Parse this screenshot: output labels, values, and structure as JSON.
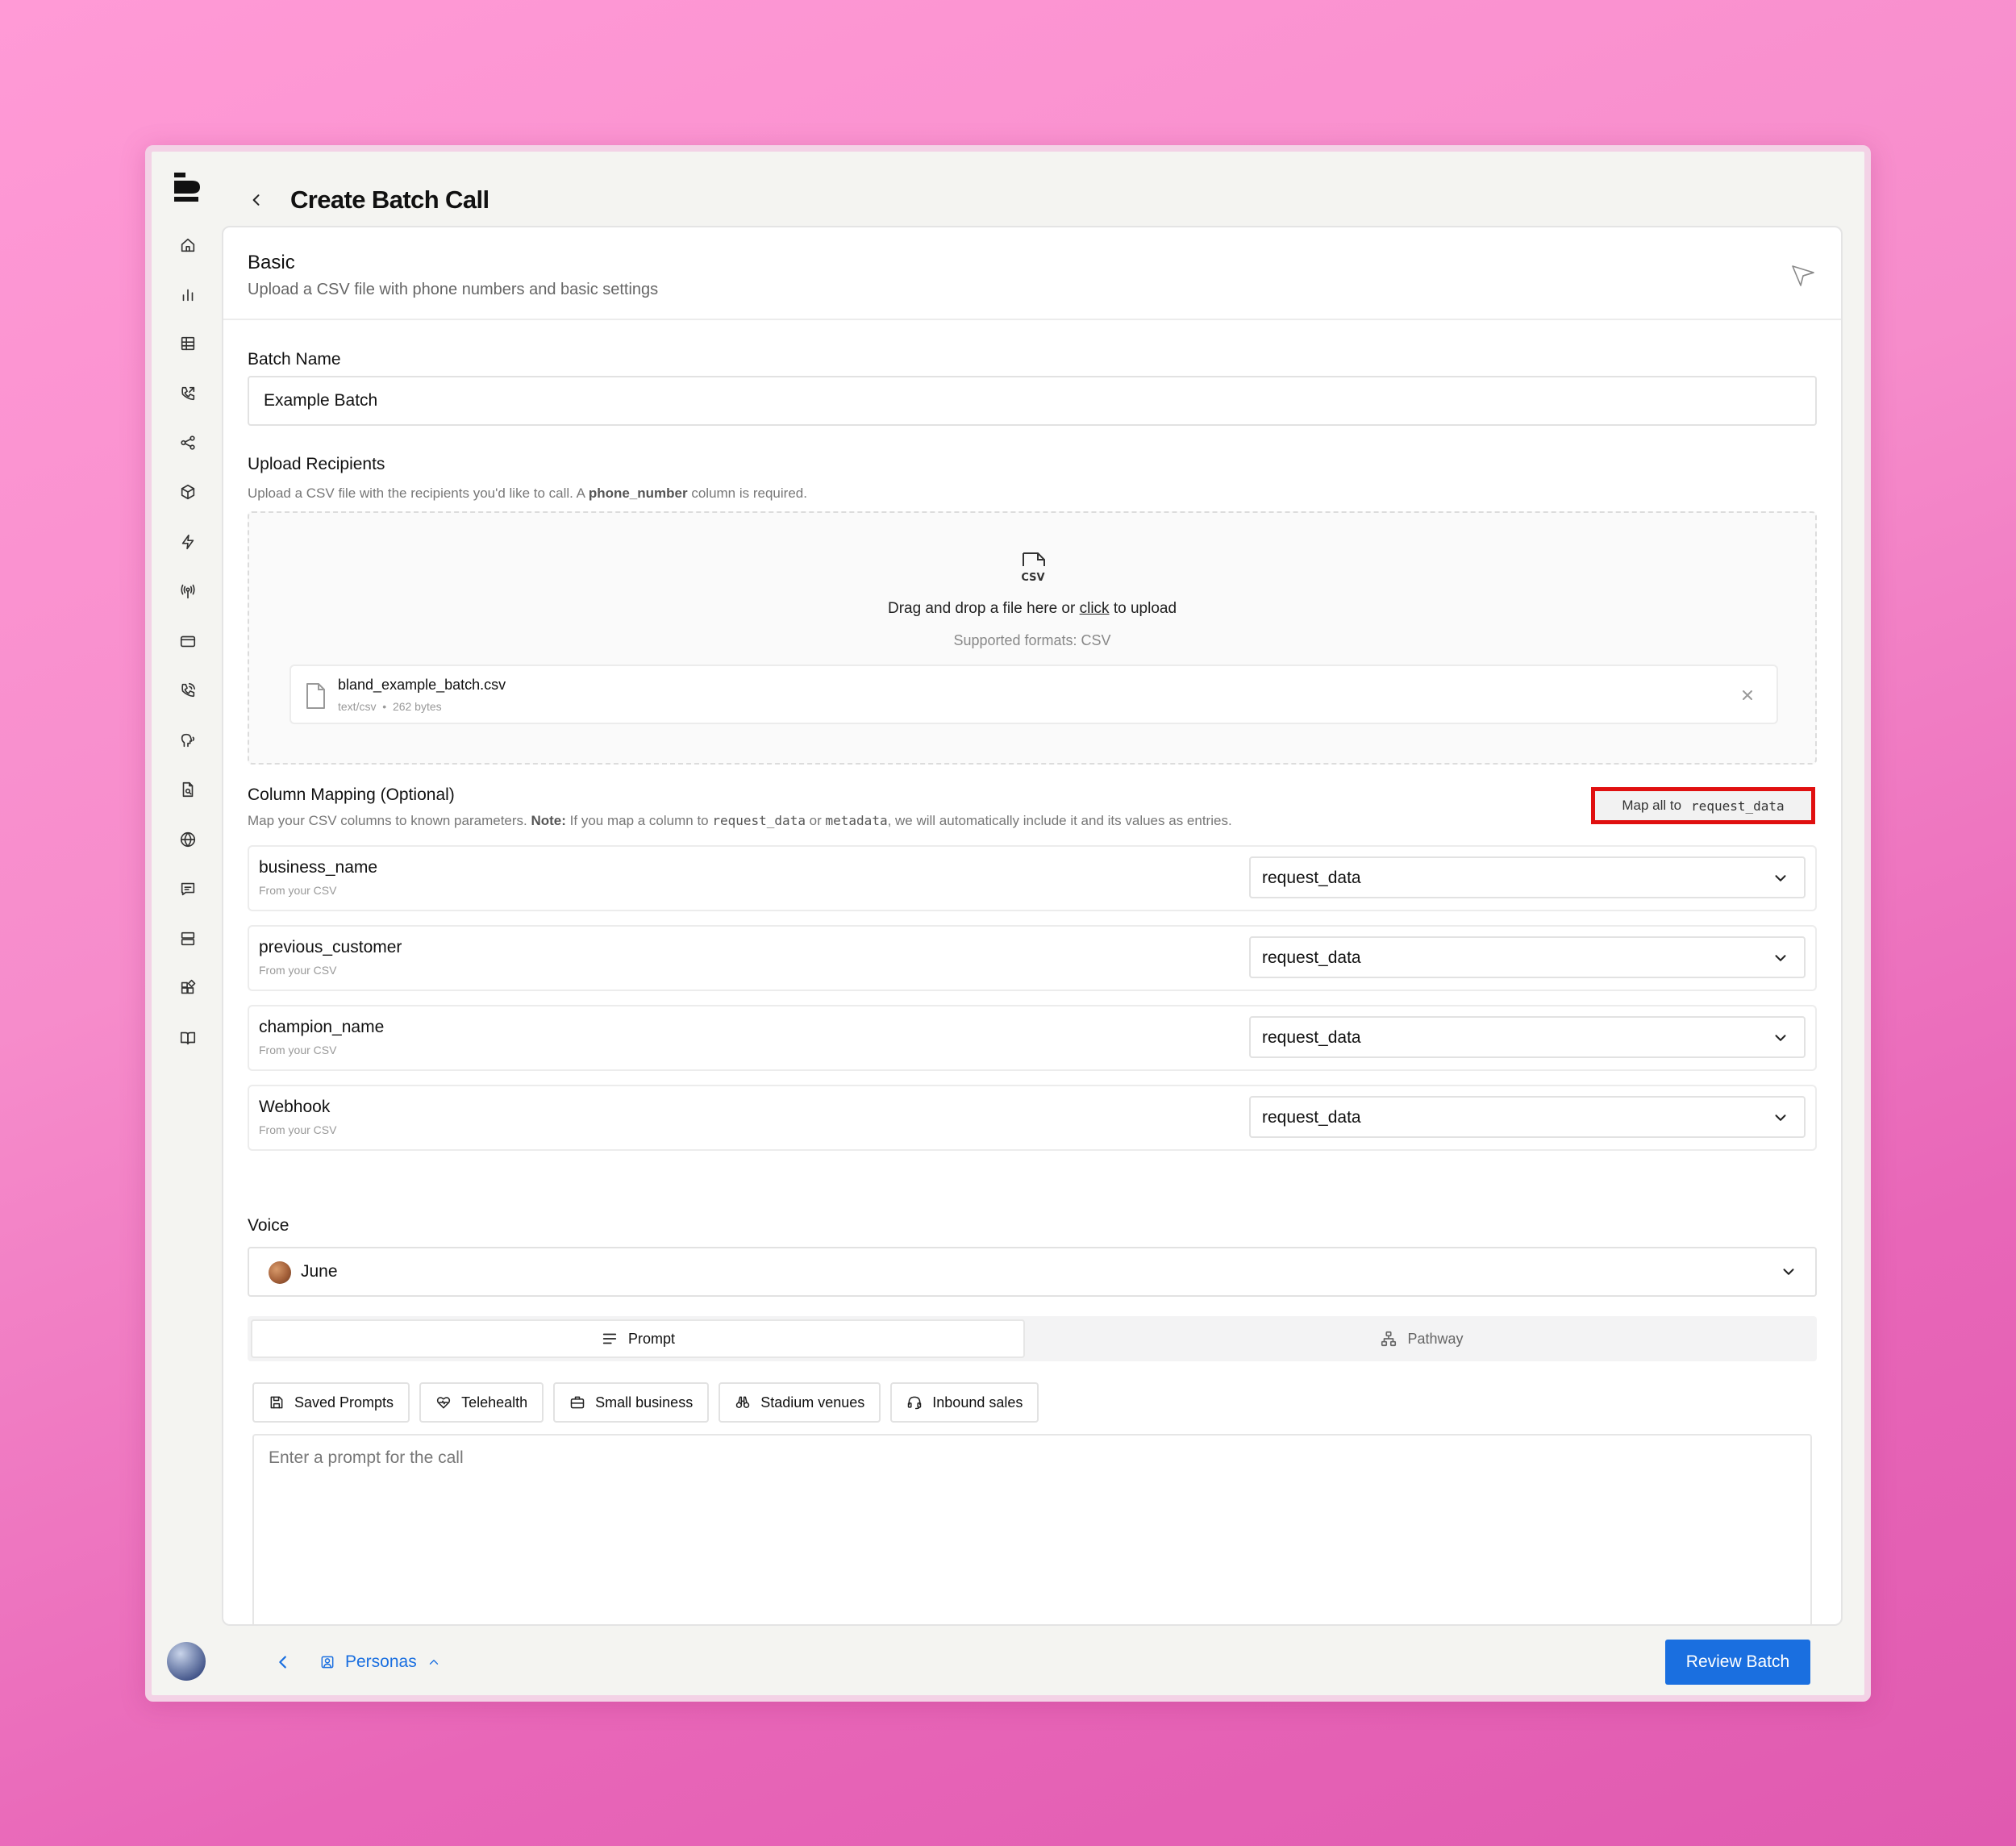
{
  "header": {
    "title": "Create Batch Call"
  },
  "basic": {
    "title": "Basic",
    "subtitle": "Upload a CSV file with phone numbers and basic settings"
  },
  "batch_name": {
    "label": "Batch Name",
    "value": "Example Batch"
  },
  "upload": {
    "label": "Upload Recipients",
    "hint_prefix": "Upload a CSV file with the recipients you'd like to call. A ",
    "hint_bold": "phone_number",
    "hint_suffix": " column is required.",
    "csv_badge": "CSV",
    "drop_prefix": "Drag and drop a file here or ",
    "drop_link": "click",
    "drop_suffix": " to upload",
    "formats": "Supported formats: CSV",
    "file": {
      "name": "bland_example_batch.csv",
      "type": "text/csv",
      "separator": "•",
      "size": "262 bytes"
    }
  },
  "mapping": {
    "label": "Column Mapping (Optional)",
    "hint_prefix": "Map your CSV columns to known parameters. ",
    "hint_note": "Note:",
    "hint_mid1": " If you map a column to ",
    "hint_code1": "request_data",
    "hint_mid2": " or ",
    "hint_code2": "metadata",
    "hint_suffix": ", we will automatically include it and its values as entries.",
    "map_all_prefix": "Map all to",
    "map_all_code": "request_data",
    "rows": [
      {
        "column": "business_name",
        "source": "From your CSV",
        "value": "request_data"
      },
      {
        "column": "previous_customer",
        "source": "From your CSV",
        "value": "request_data"
      },
      {
        "column": "champion_name",
        "source": "From your CSV",
        "value": "request_data"
      },
      {
        "column": "Webhook",
        "source": "From your CSV",
        "value": "request_data"
      }
    ]
  },
  "voice": {
    "label": "Voice",
    "value": "June"
  },
  "tabs": {
    "prompt": "Prompt",
    "pathway": "Pathway"
  },
  "chips": [
    "Saved Prompts",
    "Telehealth",
    "Small business",
    "Stadium venues",
    "Inbound sales"
  ],
  "prompt": {
    "placeholder": "Enter a prompt for the call"
  },
  "footer": {
    "personas": "Personas",
    "review": "Review Batch"
  },
  "colors": {
    "accent": "#1a6fe0",
    "highlight": "#e01010"
  }
}
